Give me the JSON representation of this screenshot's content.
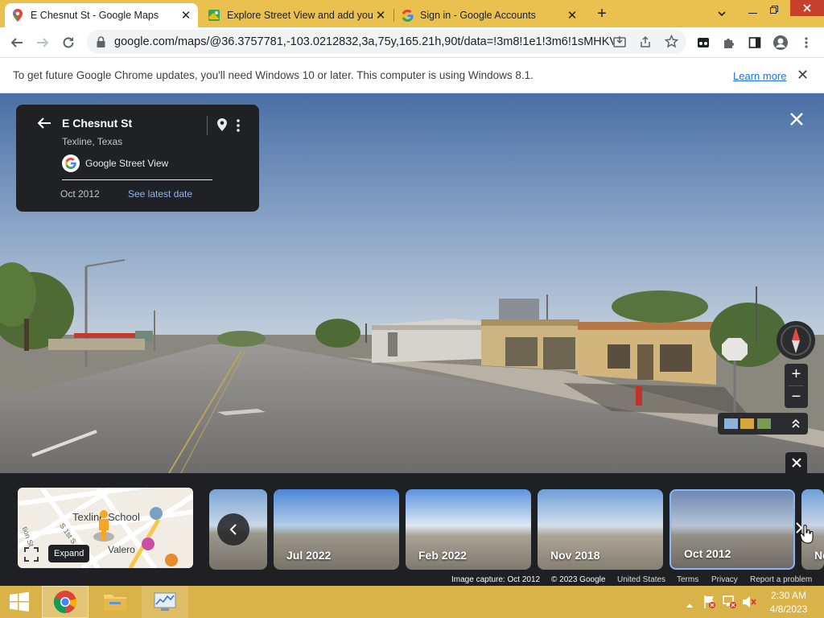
{
  "browser": {
    "tabs": [
      {
        "title": "E Chesnut St - Google Maps",
        "icon": "maps-pin-icon",
        "active": true
      },
      {
        "title": "Explore Street View and add you",
        "icon": "streetview-icon",
        "active": false
      },
      {
        "title": "Sign in - Google Accounts",
        "icon": "google-g-icon",
        "active": false
      }
    ],
    "new_tab_symbol": "+",
    "tab_close_symbol": "✕",
    "url": "google.com/maps/@36.3757781,-103.0212832,3a,75y,165.21h,90t/data=!3m8!1e1!3m6!1sMHKV..."
  },
  "infobar": {
    "message": "To get future Google Chrome updates, you'll need Windows 10 or later. This computer is using Windows 8.1.",
    "link": "Learn more",
    "close_symbol": "✕"
  },
  "infocard": {
    "street": "E Chesnut St",
    "city": "Texline, Texas",
    "source": "Google Street View",
    "date": "Oct 2012",
    "latest_link": "See latest date"
  },
  "controls": {
    "zoom_in": "+",
    "zoom_out": "−",
    "close_symbol": "✕"
  },
  "minimap": {
    "labels": [
      "Texline School",
      "Valero",
      "S 1st S",
      "tion St"
    ],
    "expand_label": "Expand"
  },
  "timeline": [
    {
      "label": "Jul 2022"
    },
    {
      "label": "Feb 2022"
    },
    {
      "label": "Nov 2018"
    },
    {
      "label": "Oct 2012"
    },
    {
      "label": "No"
    }
  ],
  "footer": {
    "capture": "Image capture: Oct 2012",
    "copyright": "© 2023 Google",
    "region": "United States",
    "terms": "Terms",
    "privacy": "Privacy",
    "report": "Report a problem"
  },
  "taskbar": {
    "time": "2:30 AM",
    "date": "4/8/2023"
  },
  "colors": {
    "tabbar": "#eac14e",
    "taskbar": "#d9b24a",
    "link_blue": "#8ab4f8",
    "panel_dark": "#202124"
  }
}
